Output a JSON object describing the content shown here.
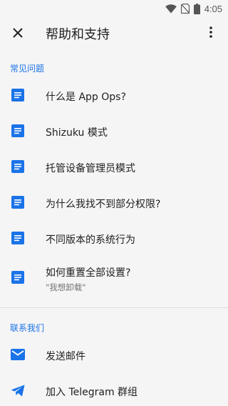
{
  "status_bar": {
    "time": "4:05",
    "icons": [
      "wifi-icon",
      "no-sim-icon",
      "battery-icon"
    ]
  },
  "app_bar": {
    "title": "帮助和支持",
    "nav_icon": "close-icon",
    "menu_icon": "more-vert-icon"
  },
  "faq": {
    "header": "常见问题",
    "items": [
      {
        "icon": "document-icon",
        "title": "什么是 App Ops?",
        "subtitle": ""
      },
      {
        "icon": "document-icon",
        "title": "Shizuku 模式",
        "subtitle": ""
      },
      {
        "icon": "document-icon",
        "title": "托管设备管理员模式",
        "subtitle": ""
      },
      {
        "icon": "document-icon",
        "title": "为什么我找不到部分权限?",
        "subtitle": ""
      },
      {
        "icon": "document-icon",
        "title": "不同版本的系统行为",
        "subtitle": ""
      },
      {
        "icon": "document-icon",
        "title": "如何重置全部设置?",
        "subtitle": "\"我想卸载\""
      }
    ]
  },
  "contact": {
    "header": "联系我们",
    "items": [
      {
        "icon": "email-icon",
        "title": "发送邮件"
      },
      {
        "icon": "telegram-icon",
        "title": "加入 Telegram 群组"
      }
    ]
  },
  "colors": {
    "accent": "#1a73e8",
    "background": "#f5f5f5",
    "text_primary": "#212121",
    "text_secondary": "#757575"
  }
}
